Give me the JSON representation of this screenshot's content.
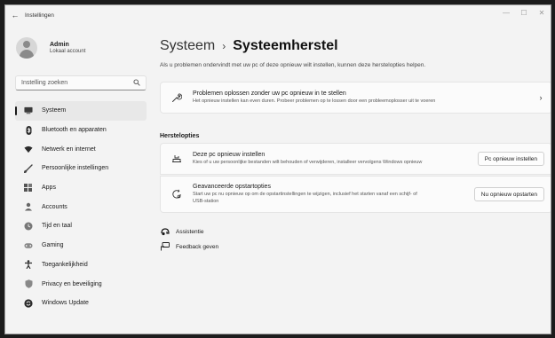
{
  "window": {
    "title": "Instellingen",
    "back_glyph": "←",
    "controls": {
      "minimize": "—",
      "maximize": "☐",
      "close": "✕"
    }
  },
  "profile": {
    "name": "Admin",
    "subtitle": "Lokaal account"
  },
  "search": {
    "placeholder": "Instelling zoeken",
    "icon": "search-icon"
  },
  "sidebar": {
    "items": [
      {
        "label": "Systeem",
        "icon": "system-icon",
        "active": true,
        "color": "#3a3a3a"
      },
      {
        "label": "Bluetooth en apparaten",
        "icon": "bluetooth-icon",
        "color": "#2b2b2b"
      },
      {
        "label": "Netwerk en internet",
        "icon": "network-icon",
        "color": "#2b2b2b"
      },
      {
        "label": "Persoonlijke instellingen",
        "icon": "brush-icon",
        "color": "#444444"
      },
      {
        "label": "Apps",
        "icon": "apps-icon",
        "color": "#555555"
      },
      {
        "label": "Accounts",
        "icon": "accounts-icon",
        "color": "#666666"
      },
      {
        "label": "Tijd en taal",
        "icon": "globe-clock-icon",
        "color": "#777777"
      },
      {
        "label": "Gaming",
        "icon": "gamepad-icon",
        "color": "#888888"
      },
      {
        "label": "Toegankelijkheid",
        "icon": "accessibility-icon",
        "color": "#2b2b2b"
      },
      {
        "label": "Privacy en beveiliging",
        "icon": "shield-icon",
        "color": "#888888"
      },
      {
        "label": "Windows Update",
        "icon": "update-icon",
        "color": "#2b2b2b"
      }
    ]
  },
  "main": {
    "breadcrumb": {
      "parent": "Systeem",
      "separator": "›",
      "current": "Systeemherstel"
    },
    "intro": "Als u problemen ondervindt met uw pc of deze opnieuw wilt instellen, kunnen deze herstelopties helpen.",
    "troubleshoot_card": {
      "title": "Problemen oplossen zonder uw pc opnieuw in te stellen",
      "desc": "Het opnieuw instellen kan even duren. Probeer problemen op te lossen door een probleemoplosser uit te voeren",
      "chevron": "›"
    },
    "section_title": "Herstelopties",
    "reset_card": {
      "title": "Deze pc opnieuw instellen",
      "desc": "Kies of u uw persoonlijke bestanden wilt behouden of verwijderen, installeer vervolgens Windows opnieuw",
      "button": "Pc opnieuw instellen"
    },
    "advanced_card": {
      "title": "Geavanceerde opstartopties",
      "desc_line1": "Start uw pc nu opnieuw op om de opstartinstellingen te wijzigen, inclusief het starten vanaf een schijf- of",
      "desc_line2": "USB-station",
      "button": "Nu opnieuw opstarten"
    },
    "links": [
      {
        "label": "Assistentie",
        "icon": "help-icon"
      },
      {
        "label": "Feedback geven",
        "icon": "feedback-icon"
      }
    ]
  }
}
